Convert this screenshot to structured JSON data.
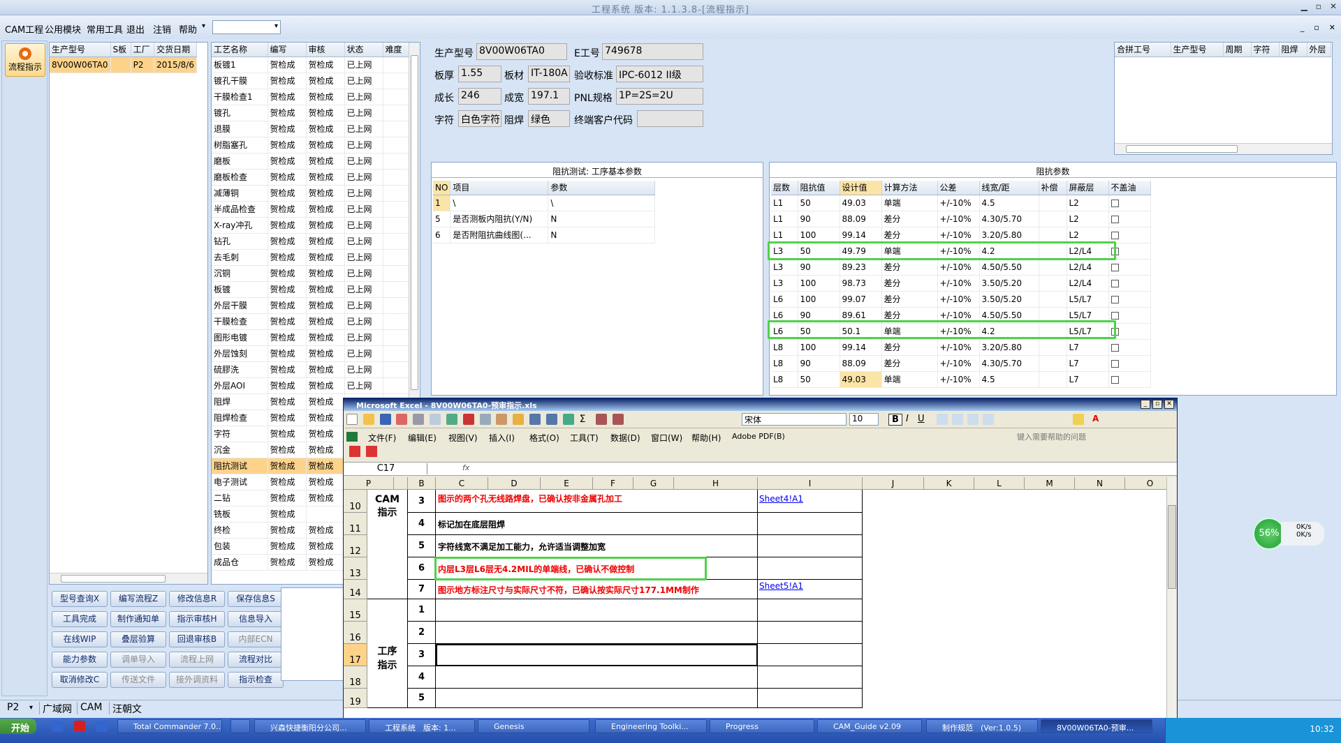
{
  "window": {
    "title": "工程系统 版本: 1.1.3.8-[流程指示]",
    "buttons": [
      "▁",
      "▫",
      "✕"
    ]
  },
  "menu": {
    "items": [
      "CAM工程",
      "公用模块",
      "常用工具",
      "退出",
      "注销",
      "帮助"
    ],
    "help_arrow": "▾",
    "mdi_buttons": [
      "_",
      "▫",
      "✕"
    ]
  },
  "leftnav": {
    "flow_label": "流程指示"
  },
  "order_grid": {
    "headers": [
      "生产型号",
      "S板",
      "工厂",
      "交货日期"
    ],
    "rows": [
      [
        "8V00W06TA0",
        "",
        "P2",
        "2015/8/6"
      ]
    ]
  },
  "process_grid": {
    "headers": [
      "工艺名称",
      "编写",
      "审核",
      "状态",
      "难度"
    ],
    "rows": [
      [
        "板镀1",
        "贺检成",
        "贺检成",
        "已上网",
        ""
      ],
      [
        "镀孔干膜",
        "贺检成",
        "贺检成",
        "已上网",
        ""
      ],
      [
        "干膜检查1",
        "贺检成",
        "贺检成",
        "已上网",
        ""
      ],
      [
        "镀孔",
        "贺检成",
        "贺检成",
        "已上网",
        ""
      ],
      [
        "退膜",
        "贺检成",
        "贺检成",
        "已上网",
        ""
      ],
      [
        "树脂塞孔",
        "贺检成",
        "贺检成",
        "已上网",
        ""
      ],
      [
        "磨板",
        "贺检成",
        "贺检成",
        "已上网",
        ""
      ],
      [
        "磨板检查",
        "贺检成",
        "贺检成",
        "已上网",
        ""
      ],
      [
        "减薄铜",
        "贺检成",
        "贺检成",
        "已上网",
        ""
      ],
      [
        "半成品检查",
        "贺检成",
        "贺检成",
        "已上网",
        ""
      ],
      [
        "X-ray冲孔",
        "贺检成",
        "贺检成",
        "已上网",
        ""
      ],
      [
        "钻孔",
        "贺检成",
        "贺检成",
        "已上网",
        ""
      ],
      [
        "去毛刺",
        "贺检成",
        "贺检成",
        "已上网",
        ""
      ],
      [
        "沉铜",
        "贺检成",
        "贺检成",
        "已上网",
        ""
      ],
      [
        "板镀",
        "贺检成",
        "贺检成",
        "已上网",
        ""
      ],
      [
        "外层干膜",
        "贺检成",
        "贺检成",
        "已上网",
        ""
      ],
      [
        "干膜检查",
        "贺检成",
        "贺检成",
        "已上网",
        ""
      ],
      [
        "图形电镀",
        "贺检成",
        "贺检成",
        "已上网",
        ""
      ],
      [
        "外层蚀刻",
        "贺检成",
        "贺检成",
        "已上网",
        ""
      ],
      [
        "硫膠洗",
        "贺检成",
        "贺检成",
        "已上网",
        ""
      ],
      [
        "外层AOI",
        "贺检成",
        "贺检成",
        "已上网",
        ""
      ],
      [
        "阻焊",
        "贺检成",
        "贺检成",
        "",
        ""
      ],
      [
        "阻焊检查",
        "贺检成",
        "贺检成",
        "",
        ""
      ],
      [
        "字符",
        "贺检成",
        "贺检成",
        "",
        ""
      ],
      [
        "沉金",
        "贺检成",
        "贺检成",
        "",
        ""
      ],
      [
        "阻抗测试",
        "贺检成",
        "贺检成",
        "",
        ""
      ],
      [
        "电子测试",
        "贺检成",
        "贺检成",
        "",
        ""
      ],
      [
        "二钻",
        "贺检成",
        "贺检成",
        "",
        ""
      ],
      [
        "铣板",
        "贺检成",
        "",
        "",
        ""
      ],
      [
        "终检",
        "贺检成",
        "贺检成",
        "",
        ""
      ],
      [
        "包装",
        "贺检成",
        "贺检成",
        "",
        ""
      ],
      [
        "成品仓",
        "贺检成",
        "贺检成",
        "",
        ""
      ]
    ]
  },
  "info": {
    "product_no_label": "生产型号",
    "product_no": "8V00W06TA0",
    "e_no_label": "E工号",
    "e_no": "749678",
    "thickness_label": "板厚",
    "thickness": "1.55",
    "material_label": "板材",
    "material": "IT-180A",
    "standard_label": "验收标准",
    "standard": "IPC-6012 II级",
    "length_label": "成长",
    "length": "246",
    "width_label": "成宽",
    "width": "197.1",
    "pnl_label": "PNL规格",
    "pnl": "1P=2S=2U",
    "char_label": "字符",
    "char": "白色字符",
    "mask_label": "阻焊",
    "mask": "绿色",
    "customer_label": "终端客户代码",
    "customer": ""
  },
  "merge_grid": {
    "headers": [
      "合拼工号",
      "生产型号",
      "周期",
      "字符",
      "阻焊",
      "外层"
    ]
  },
  "imp_test": {
    "title": "阻抗测试: 工序基本参数",
    "headers": [
      "NO",
      "项目",
      "参数"
    ],
    "rows": [
      [
        "1",
        "\\",
        "\\"
      ],
      [
        "5",
        "是否测板内阻抗(Y/N)",
        "N"
      ],
      [
        "6",
        "是否附阻抗曲线图(...",
        "N"
      ]
    ]
  },
  "imp_params": {
    "title": "阻抗参数",
    "headers": [
      "层数",
      "阻抗值",
      "设计值",
      "计算方法",
      "公差",
      "线宽/距",
      "补偿",
      "屏蔽层",
      "不盖油"
    ],
    "rows": [
      [
        "L1",
        "50",
        "49.03",
        "单端",
        "+/-10%",
        "4.5",
        "",
        "L2"
      ],
      [
        "L1",
        "90",
        "88.09",
        "差分",
        "+/-10%",
        "4.30/5.70",
        "",
        "L2"
      ],
      [
        "L1",
        "100",
        "99.14",
        "差分",
        "+/-10%",
        "3.20/5.80",
        "",
        "L2"
      ],
      [
        "L3",
        "50",
        "49.79",
        "单端",
        "+/-10%",
        "4.2",
        "",
        "L2/L4"
      ],
      [
        "L3",
        "90",
        "89.23",
        "差分",
        "+/-10%",
        "4.50/5.50",
        "",
        "L2/L4"
      ],
      [
        "L3",
        "100",
        "98.73",
        "差分",
        "+/-10%",
        "3.50/5.20",
        "",
        "L2/L4"
      ],
      [
        "L6",
        "100",
        "99.07",
        "差分",
        "+/-10%",
        "3.50/5.20",
        "",
        "L5/L7"
      ],
      [
        "L6",
        "90",
        "89.61",
        "差分",
        "+/-10%",
        "4.50/5.50",
        "",
        "L5/L7"
      ],
      [
        "L6",
        "50",
        "50.1",
        "单端",
        "+/-10%",
        "4.2",
        "",
        "L5/L7"
      ],
      [
        "L8",
        "100",
        "99.14",
        "差分",
        "+/-10%",
        "3.20/5.80",
        "",
        "L7"
      ],
      [
        "L8",
        "90",
        "88.09",
        "差分",
        "+/-10%",
        "4.30/5.70",
        "",
        "L7"
      ],
      [
        "L8",
        "50",
        "49.03",
        "单端",
        "+/-10%",
        "4.5",
        "",
        "L7"
      ]
    ]
  },
  "buttons": [
    [
      "型号查询X",
      "编写流程Z",
      "修改信息R",
      "保存信息S"
    ],
    [
      "工具完成",
      "制作通知单",
      "指示审核H",
      "信息导入"
    ],
    [
      "在线WIP",
      "叠层验算",
      "回退审核B",
      "内部ECN"
    ],
    [
      "能力参数",
      "调单导入",
      "流程上网",
      "流程对比"
    ],
    [
      "取消修改C",
      "传送文件",
      "接外调资料",
      "指示检查"
    ]
  ],
  "status": {
    "items": [
      "P2",
      "广域网",
      "CAM",
      "汪朝文"
    ],
    "arrow": "▾"
  },
  "excel": {
    "title": "Microsoft Excel - 8V00W06TA0-预审指示.xls",
    "font": "宋体",
    "size": "10",
    "menus": [
      "文件(F)",
      "编辑(E)",
      "视图(V)",
      "插入(I)",
      "格式(O)",
      "工具(T)",
      "数据(D)",
      "窗口(W)",
      "帮助(H)",
      "Adobe PDF(B)"
    ],
    "help_placeholder": "键入需要帮助的问题",
    "namebox": "C17",
    "fx": "fx",
    "columns": [
      "A",
      "B",
      "C",
      "D",
      "E",
      "F",
      "G",
      "H",
      "I",
      "J",
      "K",
      "L",
      "M",
      "N",
      "O",
      "P"
    ],
    "rows": [
      "10",
      "11",
      "12",
      "13",
      "14",
      "15",
      "16",
      "17",
      "18",
      "19"
    ],
    "cam_label": "CAM指示",
    "proc_label": "工序指示",
    "b_vals": [
      "3",
      "4",
      "5",
      "6",
      "7",
      "1",
      "2",
      "3",
      "4",
      "5"
    ],
    "lines": [
      "图示的两个孔无线路焊盘，已确认按非金属孔加工",
      "标记加在底层阻焊",
      "字符线宽不满足加工能力，允许适当调整加宽",
      "内层L3层L6层无4.2MIL的单端线，已确认不做控制",
      "图示地方标注尺寸与实际尺寸不符，已确认按实际尺寸177.1MM制作"
    ],
    "link1": "Sheet4!A1",
    "link2": "Sheet5!A1"
  },
  "netmeter": {
    "percent": "56%",
    "up": "0K/s",
    "down": "0K/s"
  },
  "taskbar": {
    "start": "开始",
    "tasks": [
      "Total Commander 7.0...",
      "",
      "兴森快捷衡阳分公司...",
      "工程系统　版本: 1...",
      "Genesis",
      "Engineering Toolki...",
      "Progress",
      "CAM_Guide v2.09",
      "制作规范　(Ver:1.0.5)",
      "8V00W06TA0-预审..."
    ],
    "time": "10:32"
  },
  "colors": {
    "accent": "#4fd14a",
    "highlight": "#fbe4a7",
    "excel_red": "#ee0000"
  }
}
